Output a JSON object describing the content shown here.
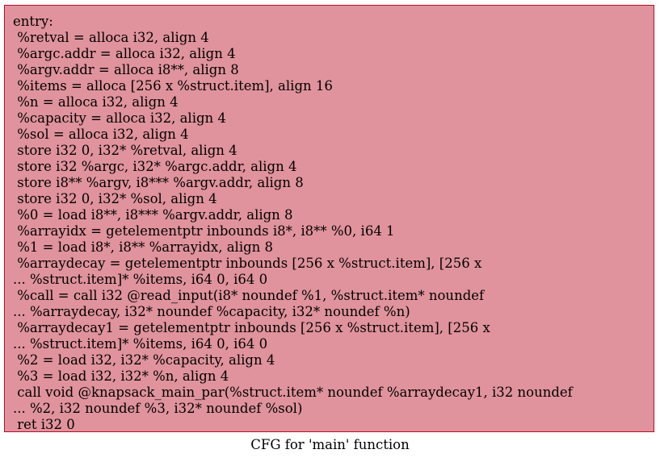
{
  "block": {
    "lines": [
      "entry:",
      " %retval = alloca i32, align 4",
      " %argc.addr = alloca i32, align 4",
      " %argv.addr = alloca i8**, align 8",
      " %items = alloca [256 x %struct.item], align 16",
      " %n = alloca i32, align 4",
      " %capacity = alloca i32, align 4",
      " %sol = alloca i32, align 4",
      " store i32 0, i32* %retval, align 4",
      " store i32 %argc, i32* %argc.addr, align 4",
      " store i8** %argv, i8*** %argv.addr, align 8",
      " store i32 0, i32* %sol, align 4",
      " %0 = load i8**, i8*** %argv.addr, align 8",
      " %arrayidx = getelementptr inbounds i8*, i8** %0, i64 1",
      " %1 = load i8*, i8** %arrayidx, align 8",
      " %arraydecay = getelementptr inbounds [256 x %struct.item], [256 x",
      "... %struct.item]* %items, i64 0, i64 0",
      " %call = call i32 @read_input(i8* noundef %1, %struct.item* noundef",
      "... %arraydecay, i32* noundef %capacity, i32* noundef %n)",
      " %arraydecay1 = getelementptr inbounds [256 x %struct.item], [256 x",
      "... %struct.item]* %items, i64 0, i64 0",
      " %2 = load i32, i32* %capacity, align 4",
      " %3 = load i32, i32* %n, align 4",
      " call void @knapsack_main_par(%struct.item* noundef %arraydecay1, i32 noundef",
      "... %2, i32 noundef %3, i32* noundef %sol)",
      " ret i32 0"
    ]
  },
  "caption": "CFG for 'main' function",
  "colors": {
    "node_fill": "#e0939c",
    "node_border": "#b70d28",
    "text": "#000000"
  }
}
